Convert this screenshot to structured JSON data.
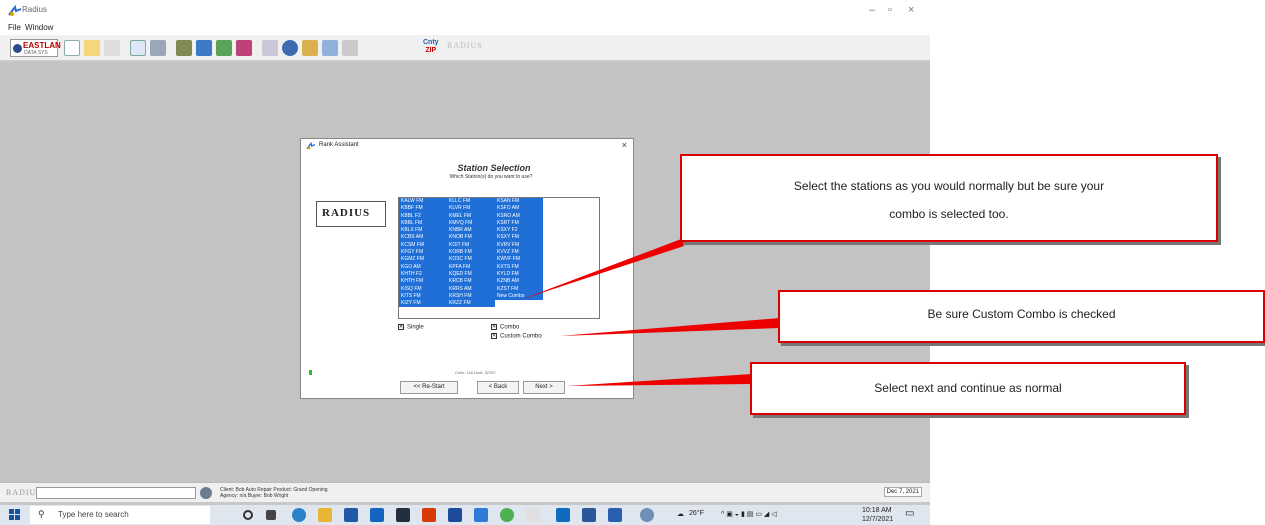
{
  "window": {
    "title": "Radius"
  },
  "menu": [
    {
      "label": "File"
    },
    {
      "label": "Window"
    }
  ],
  "toolbar": {
    "logo_text": "EASTLAN",
    "logo_sub": "DATA SYS",
    "zip_top": "Cnty",
    "zip_bottom": "ZIP",
    "radius_text": "RADIUS"
  },
  "dialog": {
    "title": "Rank Assistant",
    "heading": "Station Selection",
    "subheading": "Which Station(s) do you want to use?",
    "logo": "RADIUS",
    "stations_col1": [
      "KALW FM",
      "KBBF FM",
      "KBBL F2",
      "KBBL FM",
      "KBLX FM",
      "KCBS AM",
      "KCSM FM",
      "KFGY FM",
      "KGMZ FM",
      "KGO AM",
      "KHTH F2",
      "KHTH FM",
      "KISQ FM",
      "KITS FM",
      "KIZY FM"
    ],
    "stations_col2": [
      "KLLC FM",
      "KLVR FM",
      "KMEL FM",
      "KMVQ FM",
      "KNBR AM",
      "KNOB FM",
      "KOIT FM",
      "KORB FM",
      "KOSC FM",
      "KPFA FM",
      "KQED FM",
      "KRCB FM",
      "KRRS AM",
      "KRSH FM",
      "KRZZ FM"
    ],
    "stations_col3": [
      "KSAN FM",
      "KSFO AM",
      "KSRO AM",
      "KSRT FM",
      "KSXY F2",
      "KSXY FM",
      "KVRV FM",
      "KVVZ FM",
      "KWVF FM",
      "KXTS FM",
      "KYLD FM",
      "KZNB AM",
      "KZST FM",
      "New Combo"
    ],
    "single_label": "Single",
    "combo_label": "Combo",
    "custom_combo_label": "Custom Combo",
    "cells": "Cells: 148   Limit: 32767",
    "restart_label": "<< Re-Start",
    "back_label": "< Back",
    "next_label": "Next >"
  },
  "callouts": [
    {
      "text": "Select the stations as you would normally but be sure your combo is selected too."
    },
    {
      "text": "Be sure Custom Combo is checked"
    },
    {
      "text": "Select next and continue as normal"
    }
  ],
  "status": {
    "logo": "RADIUS",
    "client_line": "Client: Bob Auto Repair   Product: Grand Opening",
    "agency_line": "Agency: n/a   Buyer: Bob Wright",
    "date": "Dec 7, 2021"
  },
  "taskbar": {
    "search_placeholder": "Type here to search",
    "weather": "26°F",
    "time": "10:18 AM",
    "date": "12/7/2021"
  },
  "colors": {
    "selection": "#1f6fd6",
    "callout_border": "#dd0000",
    "workspace": "#c3c3c3"
  }
}
